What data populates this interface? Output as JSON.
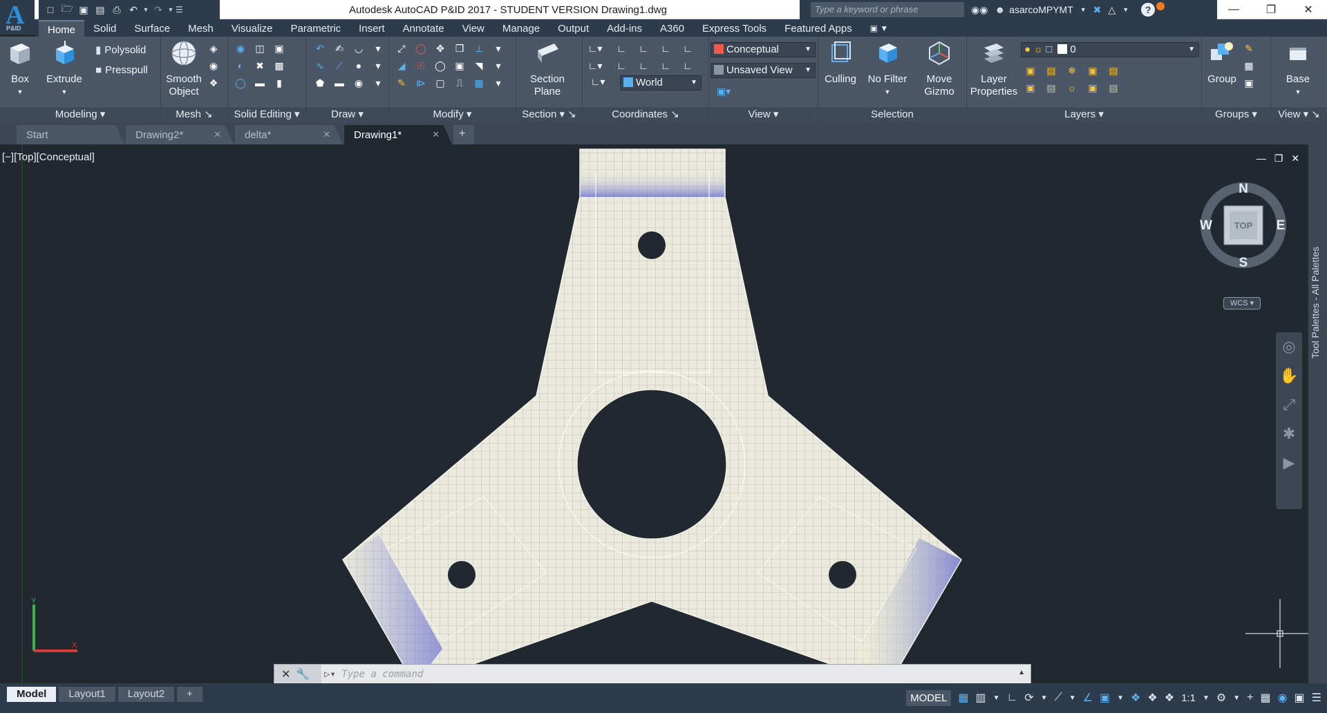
{
  "app": {
    "logo_letter": "A",
    "logo_sub": "P&ID",
    "title": "Autodesk AutoCAD P&ID 2017 - STUDENT VERSION    Drawing1.dwg",
    "search_placeholder": "Type a keyword or phrase",
    "username": "asarcoMPYMT"
  },
  "ribbon_tabs": [
    "Home",
    "Solid",
    "Surface",
    "Mesh",
    "Visualize",
    "Parametric",
    "Insert",
    "Annotate",
    "View",
    "Manage",
    "Output",
    "Add-ins",
    "A360",
    "Express Tools",
    "Featured Apps"
  ],
  "ribbon": {
    "modeling": {
      "label": "Modeling",
      "box": "Box",
      "extrude": "Extrude",
      "polysolid": "Polysolid",
      "presspull": "Presspull"
    },
    "mesh": {
      "label": "Mesh",
      "smooth_object": "Smooth Object"
    },
    "solid_editing": {
      "label": "Solid Editing"
    },
    "draw": {
      "label": "Draw"
    },
    "modify": {
      "label": "Modify"
    },
    "section": {
      "label": "Section",
      "section_plane": "Section Plane"
    },
    "coordinates": {
      "label": "Coordinates",
      "ucs": "World"
    },
    "view": {
      "label": "View",
      "visual_style": "Conceptual",
      "saved_view": "Unsaved View"
    },
    "selection": {
      "label": "Selection",
      "culling": "Culling",
      "no_filter": "No Filter",
      "move_gizmo": "Move Gizmo"
    },
    "layers": {
      "label": "Layers",
      "layer_properties": "Layer Properties",
      "current_layer": "0"
    },
    "groups": {
      "label": "Groups",
      "group": "Group"
    },
    "view2": {
      "label": "View",
      "base": "Base"
    }
  },
  "file_tabs": [
    {
      "label": "Start",
      "closable": false
    },
    {
      "label": "Drawing2*",
      "closable": true
    },
    {
      "label": "delta*",
      "closable": true
    },
    {
      "label": "Drawing1*",
      "closable": true,
      "active": true
    }
  ],
  "viewport": {
    "label": "[−][Top][Conceptual]",
    "compass": {
      "n": "N",
      "s": "S",
      "e": "E",
      "w": "W",
      "face": "TOP"
    },
    "wcs": "WCS",
    "tool_palette": "Tool Palettes - All Palettes"
  },
  "command": {
    "placeholder": "Type a command"
  },
  "layouts": [
    "Model",
    "Layout1",
    "Layout2"
  ],
  "status": {
    "space": "MODEL",
    "scale": "1:1"
  },
  "colors": {
    "accent": "#2e8fd8",
    "background": "#212830",
    "ribbon": "#4b5766"
  }
}
